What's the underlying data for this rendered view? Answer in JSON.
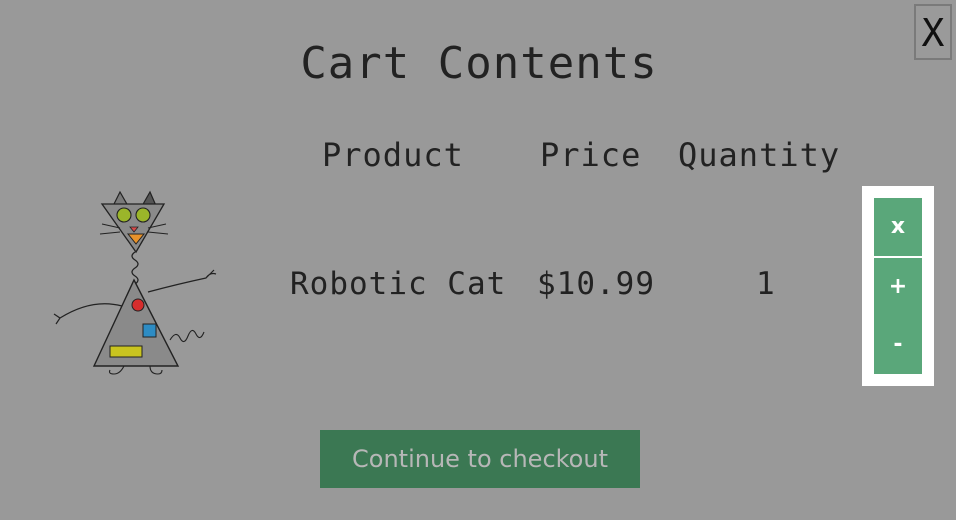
{
  "modal": {
    "close_label": "X",
    "title": "Cart Contents"
  },
  "table": {
    "headers": [
      "Product",
      "Price",
      "Quantity"
    ],
    "rows": [
      {
        "image_icon": "robotic-cat-image",
        "product": "Robotic Cat",
        "price": "$10.99",
        "quantity": "1"
      }
    ]
  },
  "controls": {
    "remove_label": "x",
    "increase_label": "+",
    "decrease_label": "-"
  },
  "checkout": {
    "label": "Continue to checkout"
  },
  "colors": {
    "overlay": "#999999",
    "button_green": "#5aa77a",
    "checkout_green": "#3b7853"
  }
}
